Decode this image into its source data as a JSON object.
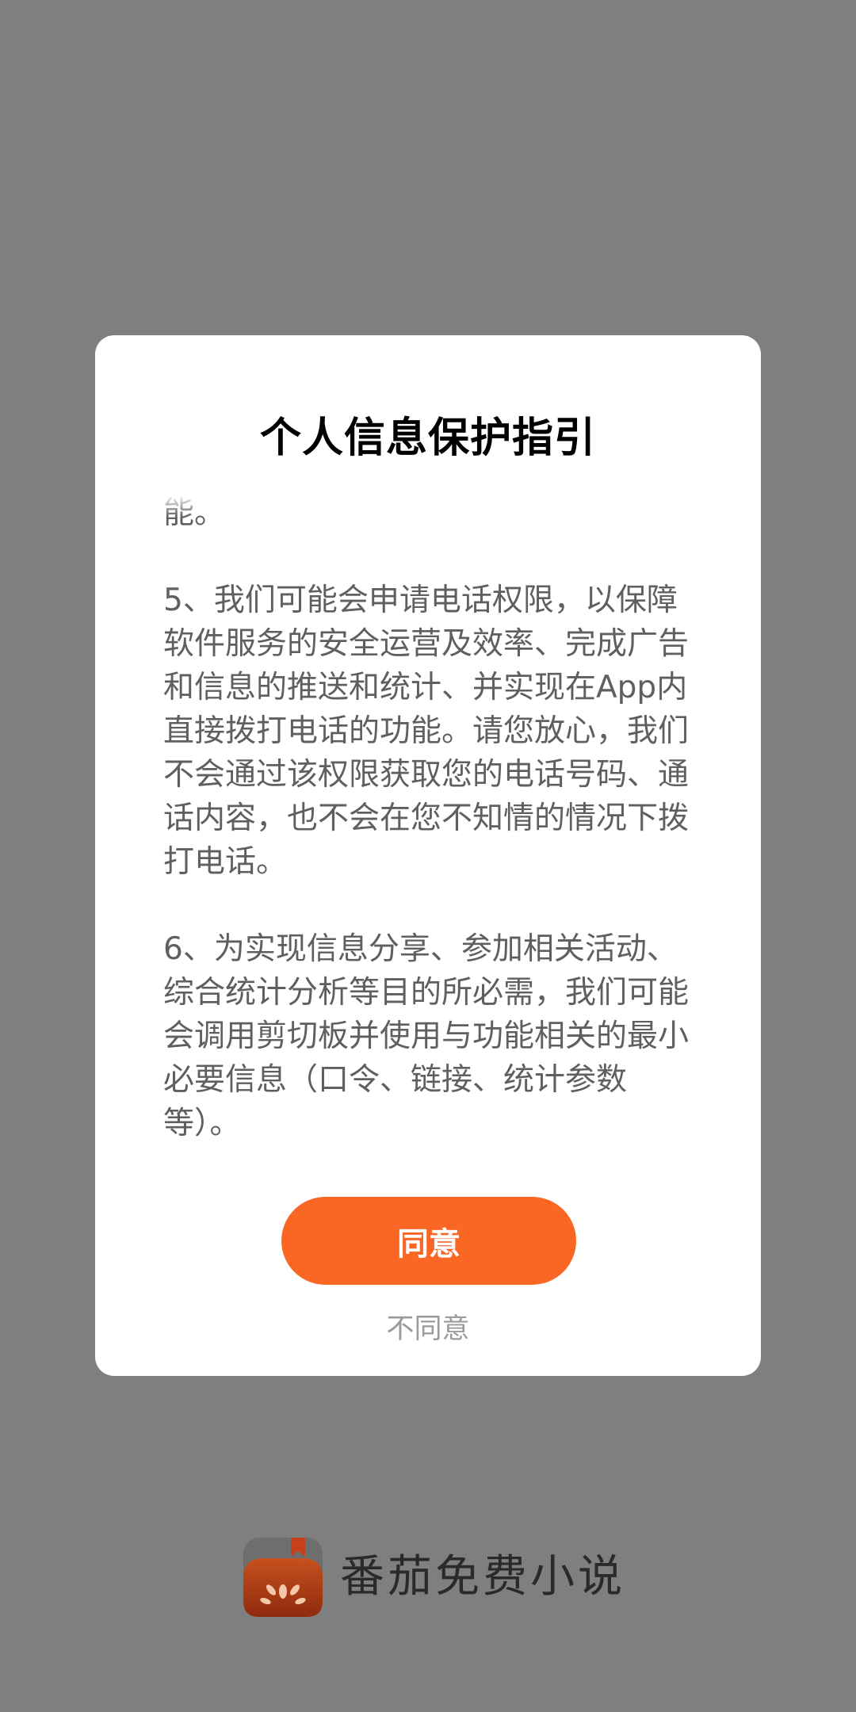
{
  "dialog": {
    "title": "个人信息保护指引",
    "paragraphs": [
      "用升级、实现相关图片和小说的下载功能。",
      "5、我们可能会申请电话权限，以保障软件服务的安全运营及效率、完成广告和信息的推送和统计、并实现在App内直接拨打电话的功能。请您放心，我们不会通过该权限获取您的电话号码、通话内容，也不会在您不知情的情况下拨打电话。",
      "6、为实现信息分享、参加相关活动、综合统计分析等目的所必需，我们可能会调用剪切板并使用与功能相关的最小必要信息（口令、链接、统计参数等）。"
    ],
    "agree_label": "同意",
    "disagree_label": "不同意"
  },
  "brand": {
    "name": "番茄免费小说",
    "logo_icon": "tomato-book-icon"
  },
  "colors": {
    "overlay": "#7f7f7f",
    "accent": "#fa6725",
    "body_text": "#5f5f5f",
    "secondary_text": "#9a9a9a"
  }
}
